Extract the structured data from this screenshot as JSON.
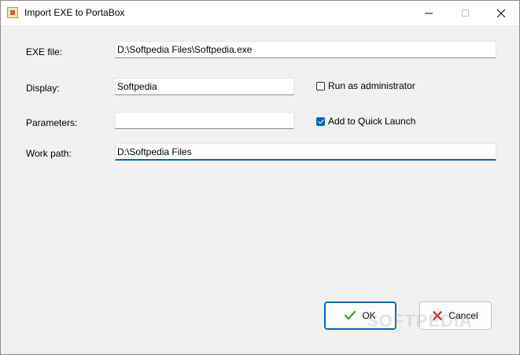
{
  "window": {
    "title": "Import EXE to PortaBox"
  },
  "form": {
    "exe_file": {
      "label": "EXE file:",
      "value": "D:\\Softpedia Files\\Softpedia.exe"
    },
    "display": {
      "label": "Display:",
      "value": "Softpedia"
    },
    "parameters": {
      "label": "Parameters:",
      "value": ""
    },
    "work_path": {
      "label": "Work path:",
      "value": "D:\\Softpedia Files"
    },
    "run_as_admin": {
      "label": "Run as administrator",
      "checked": false
    },
    "quick_launch": {
      "label": "Add to Quick Launch",
      "checked": true
    }
  },
  "buttons": {
    "ok_label": "OK",
    "cancel_label": "Cancel"
  },
  "watermark": "SOFTPEDIA",
  "colors": {
    "accent": "#0067c0",
    "ok_check": "#3c9a2e",
    "cancel_x": "#d13438"
  }
}
